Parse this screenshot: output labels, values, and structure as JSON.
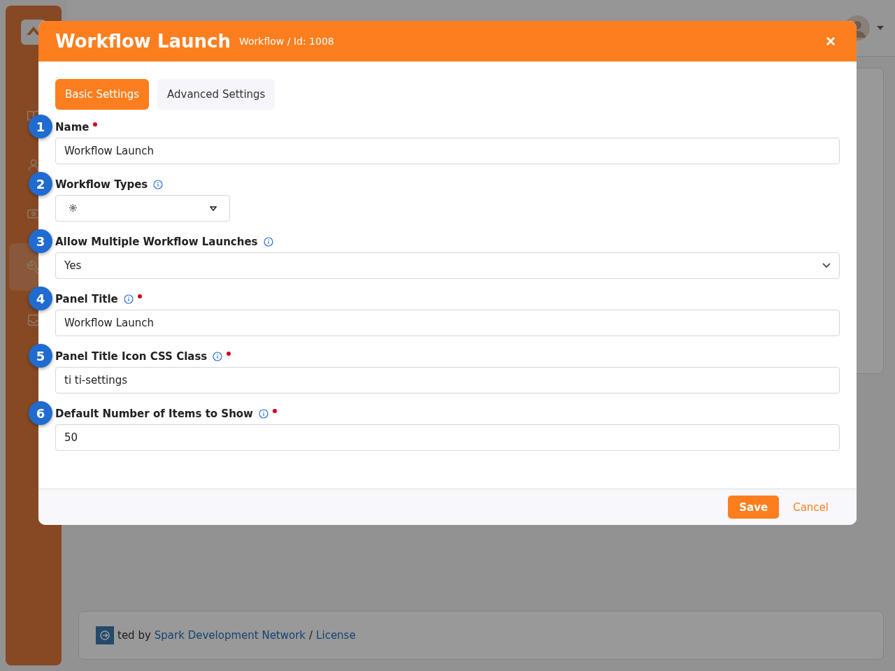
{
  "background": {
    "sidebar": {
      "items": [
        {
          "kind": "book",
          "selected": false
        },
        {
          "kind": "person",
          "selected": false
        },
        {
          "kind": "money",
          "selected": false
        },
        {
          "kind": "wrench",
          "selected": true
        },
        {
          "kind": "inbox",
          "selected": false
        }
      ]
    },
    "footer": {
      "text": "ted by",
      "link": "Spark Development Network",
      "separator": "/",
      "license": "License"
    }
  },
  "modal": {
    "title": "Workflow Launch",
    "subtitle": "Workflow / Id: 1008",
    "close": "×",
    "tabs": [
      {
        "label": "Basic Settings",
        "selected": true
      },
      {
        "label": "Advanced Settings",
        "selected": false
      }
    ],
    "fields": [
      {
        "marker": "1",
        "label": "Name",
        "info": false,
        "required": true,
        "kind": "text",
        "value": "Workflow Launch"
      },
      {
        "marker": "2",
        "label": "Workflow Types",
        "info": true,
        "required": false,
        "kind": "picker"
      },
      {
        "marker": "3",
        "label": "Allow Multiple Workflow Launches",
        "info": true,
        "required": false,
        "kind": "select",
        "value": "Yes"
      },
      {
        "marker": "4",
        "label": "Panel Title",
        "info": true,
        "required": true,
        "kind": "text",
        "value": "Workflow Launch"
      },
      {
        "marker": "5",
        "label": "Panel Title Icon CSS Class",
        "info": true,
        "required": true,
        "kind": "text",
        "value": "ti ti-settings"
      },
      {
        "marker": "6",
        "label": "Default Number of Items to Show",
        "info": true,
        "required": true,
        "kind": "text",
        "value": "50"
      }
    ],
    "buttons": {
      "save": "Save",
      "cancel": "Cancel"
    }
  }
}
